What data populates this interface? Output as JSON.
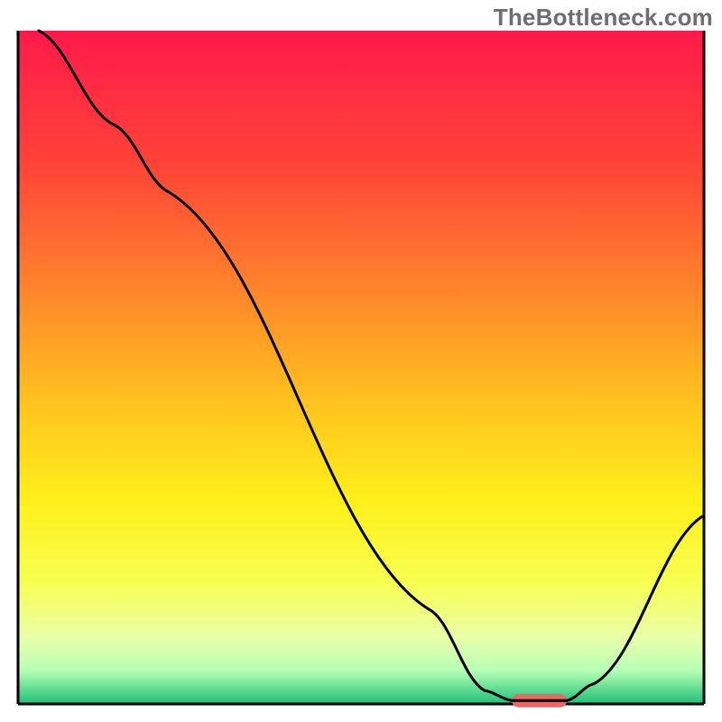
{
  "watermark": "TheBottleneck.com",
  "chart_data": {
    "type": "line",
    "title": "",
    "xlabel": "",
    "ylabel": "",
    "xlim": [
      0,
      100
    ],
    "ylim": [
      0,
      100
    ],
    "axes_visible": false,
    "grid": false,
    "background_gradient": [
      {
        "offset": 0.0,
        "color": "#ff1a4a"
      },
      {
        "offset": 0.2,
        "color": "#ff4438"
      },
      {
        "offset": 0.4,
        "color": "#ff8a2a"
      },
      {
        "offset": 0.55,
        "color": "#ffc21f"
      },
      {
        "offset": 0.7,
        "color": "#fff01a"
      },
      {
        "offset": 0.82,
        "color": "#f7ff52"
      },
      {
        "offset": 0.9,
        "color": "#eaffa8"
      },
      {
        "offset": 0.95,
        "color": "#b8ffb8"
      },
      {
        "offset": 0.98,
        "color": "#5cd98f"
      },
      {
        "offset": 1.0,
        "color": "#1fbf7a"
      }
    ],
    "series": [
      {
        "name": "bottleneck-curve",
        "color": "#000000",
        "stroke_width": 3,
        "points": [
          {
            "x": 3.0,
            "y": 100.0
          },
          {
            "x": 14.0,
            "y": 86.0
          },
          {
            "x": 22.0,
            "y": 76.0
          },
          {
            "x": 60.0,
            "y": 14.0
          },
          {
            "x": 68.0,
            "y": 2.0
          },
          {
            "x": 72.0,
            "y": 0.5
          },
          {
            "x": 80.0,
            "y": 0.5
          },
          {
            "x": 84.0,
            "y": 3.0
          },
          {
            "x": 100.0,
            "y": 28.0
          }
        ]
      }
    ],
    "markers": [
      {
        "name": "optimum-marker",
        "shape": "rounded-bar",
        "color": "#e46a6a",
        "x_start": 72.0,
        "x_end": 80.0,
        "y": 0.5,
        "height": 2.0
      }
    ],
    "frame": {
      "stroke": "#000000",
      "stroke_width": 3,
      "sides": [
        "left",
        "right",
        "bottom"
      ]
    }
  }
}
